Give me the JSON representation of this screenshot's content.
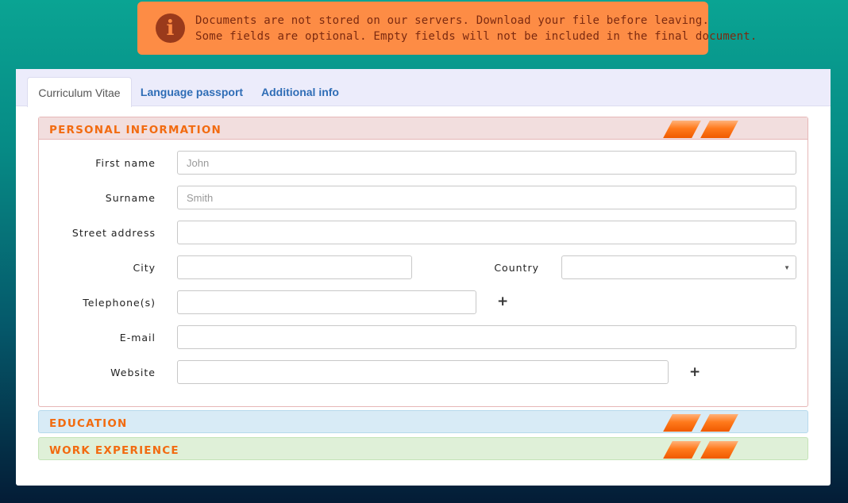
{
  "banner": {
    "icon": "info-icon",
    "line1": "Documents are not stored on our servers. Download your file before leaving.",
    "line2": "Some fields are optional. Empty fields will not be included in the final document."
  },
  "tabs": [
    {
      "label": "Curriculum Vitae",
      "active": true
    },
    {
      "label": "Language passport",
      "active": false
    },
    {
      "label": "Additional info",
      "active": false
    }
  ],
  "sections": {
    "personal": {
      "title": "PERSONAL INFORMATION"
    },
    "education": {
      "title": "EDUCATION"
    },
    "work": {
      "title": "WORK EXPERIENCE"
    }
  },
  "form": {
    "first_name": {
      "label": "First name",
      "placeholder": "John",
      "value": ""
    },
    "surname": {
      "label": "Surname",
      "placeholder": "Smith",
      "value": ""
    },
    "street": {
      "label": "Street address",
      "placeholder": "",
      "value": ""
    },
    "city": {
      "label": "City",
      "placeholder": "",
      "value": ""
    },
    "country": {
      "label": "Country",
      "value": ""
    },
    "telephone": {
      "label": "Telephone(s)",
      "placeholder": "",
      "value": "",
      "add": "+"
    },
    "email": {
      "label": "E-mail",
      "placeholder": "",
      "value": ""
    },
    "website": {
      "label": "Website",
      "placeholder": "",
      "value": "",
      "add": "+"
    }
  },
  "colors": {
    "banner_bg": "#fd8c45",
    "accent_orange": "#f26b10",
    "tab_link": "#2f6db6"
  }
}
